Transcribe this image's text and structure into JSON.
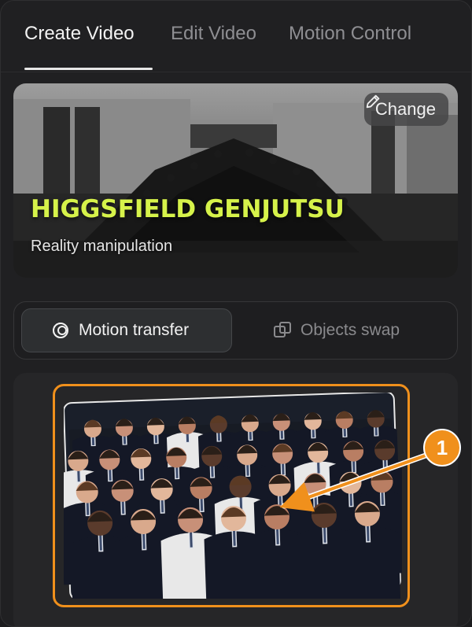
{
  "tabs": [
    {
      "label": "Create Video",
      "active": true
    },
    {
      "label": "Edit Video",
      "active": false
    },
    {
      "label": "Motion Control",
      "active": false
    }
  ],
  "hero": {
    "title": "HIGGSFIELD GENJUTSU",
    "subtitle": "Reality manipulation",
    "change_label": "Change",
    "title_color": "#d6f24a"
  },
  "mode_switch": {
    "options": [
      {
        "label": "Motion transfer",
        "icon": "motion-transfer-icon",
        "active": true
      },
      {
        "label": "Objects swap",
        "icon": "objects-swap-icon",
        "active": false
      }
    ]
  },
  "preview": {
    "image": "group-photo-students-in-uniforms",
    "highlight_color": "#f0901c"
  },
  "annotation": {
    "callout_number": "1"
  }
}
